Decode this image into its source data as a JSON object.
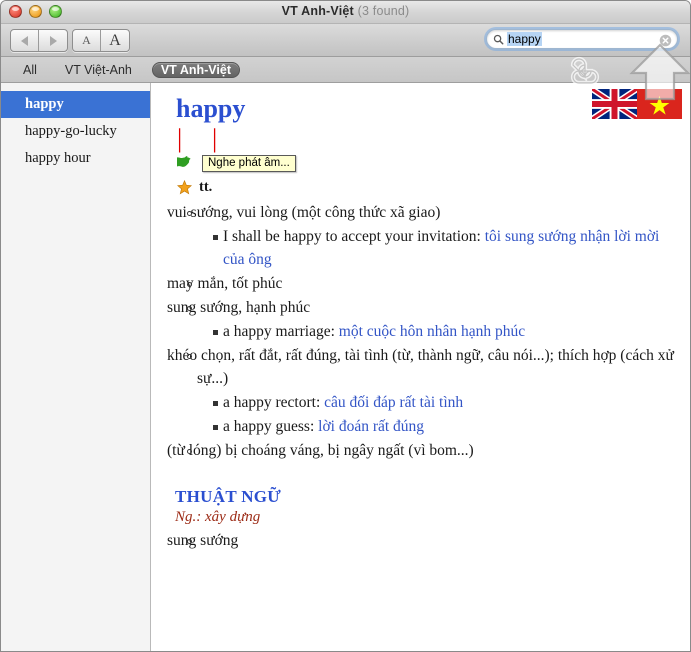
{
  "window": {
    "title": "VT Anh-Việt",
    "title_suffix": "(3 found)",
    "traffic": {
      "close": "close-button",
      "minimize": "minimize-button",
      "zoom": "zoom-button"
    }
  },
  "toolbar": {
    "back_label": "◀",
    "forward_label": "▶",
    "font_smaller_label": "A",
    "font_larger_label": "A",
    "search": {
      "value": "happy",
      "placeholder": "Search",
      "icon": "search-icon",
      "clear_icon": "clear-icon"
    }
  },
  "scopebar": {
    "tabs": [
      {
        "label": "All",
        "active": false
      },
      {
        "label": "VT Việt-Anh",
        "active": false
      },
      {
        "label": "VT Anh-Việt",
        "active": true
      }
    ]
  },
  "sidebar": {
    "items": [
      {
        "label": "happy",
        "selected": true
      },
      {
        "label": "happy-go-lucky",
        "selected": false
      },
      {
        "label": "happy hour",
        "selected": false
      }
    ]
  },
  "entry": {
    "headword": "happy",
    "pronunciation_marks": [
      "|",
      "|"
    ],
    "audio": {
      "icon": "apple-icon",
      "tooltip": "Nghe phát âm..."
    },
    "part_of_speech": {
      "icon": "star-icon",
      "label": "tt."
    },
    "flags": [
      "uk-flag",
      "vietnam-flag"
    ],
    "senses": [
      {
        "text": "vui sướng, vui lòng (một công thức xã giao)",
        "examples": [
          {
            "en": "I shall be happy to accept your invitation: ",
            "vi": "tôi sung sướng nhận lời mời của ông"
          }
        ]
      },
      {
        "text": "may mắn, tốt phúc",
        "examples": []
      },
      {
        "text": "sung sướng, hạnh phúc",
        "examples": [
          {
            "en": "a happy marriage: ",
            "vi": "một cuộc hôn nhân hạnh phúc"
          }
        ]
      },
      {
        "text": "khéo chọn, rất đắt, rất đúng, tài tình (từ, thành ngữ, câu nói...); thích hợp (cách xử sự...)",
        "examples": [
          {
            "en": "a happy rectort: ",
            "vi": "câu đối đáp rất tài tình"
          },
          {
            "en": "a happy guess: ",
            "vi": "lời đoán rất đúng"
          }
        ]
      },
      {
        "text": "(từ lóng) bị choáng váng, bị ngây ngất (vì bom...)",
        "examples": []
      }
    ],
    "terminology": {
      "section_title": "THUẬT NGỮ",
      "field_label": "Ng.: xây dựng",
      "senses": [
        {
          "text": "sung sướng",
          "examples": []
        }
      ]
    }
  },
  "overlay": {
    "keys": [
      "command-key-icon",
      "shift-key-icon"
    ]
  },
  "colors": {
    "selection_blue": "#3a72d4",
    "headword_blue": "#2b4fd0",
    "translation_blue": "#3355c6",
    "field_red": "#9c2b16",
    "pron_red": "#e00000"
  }
}
